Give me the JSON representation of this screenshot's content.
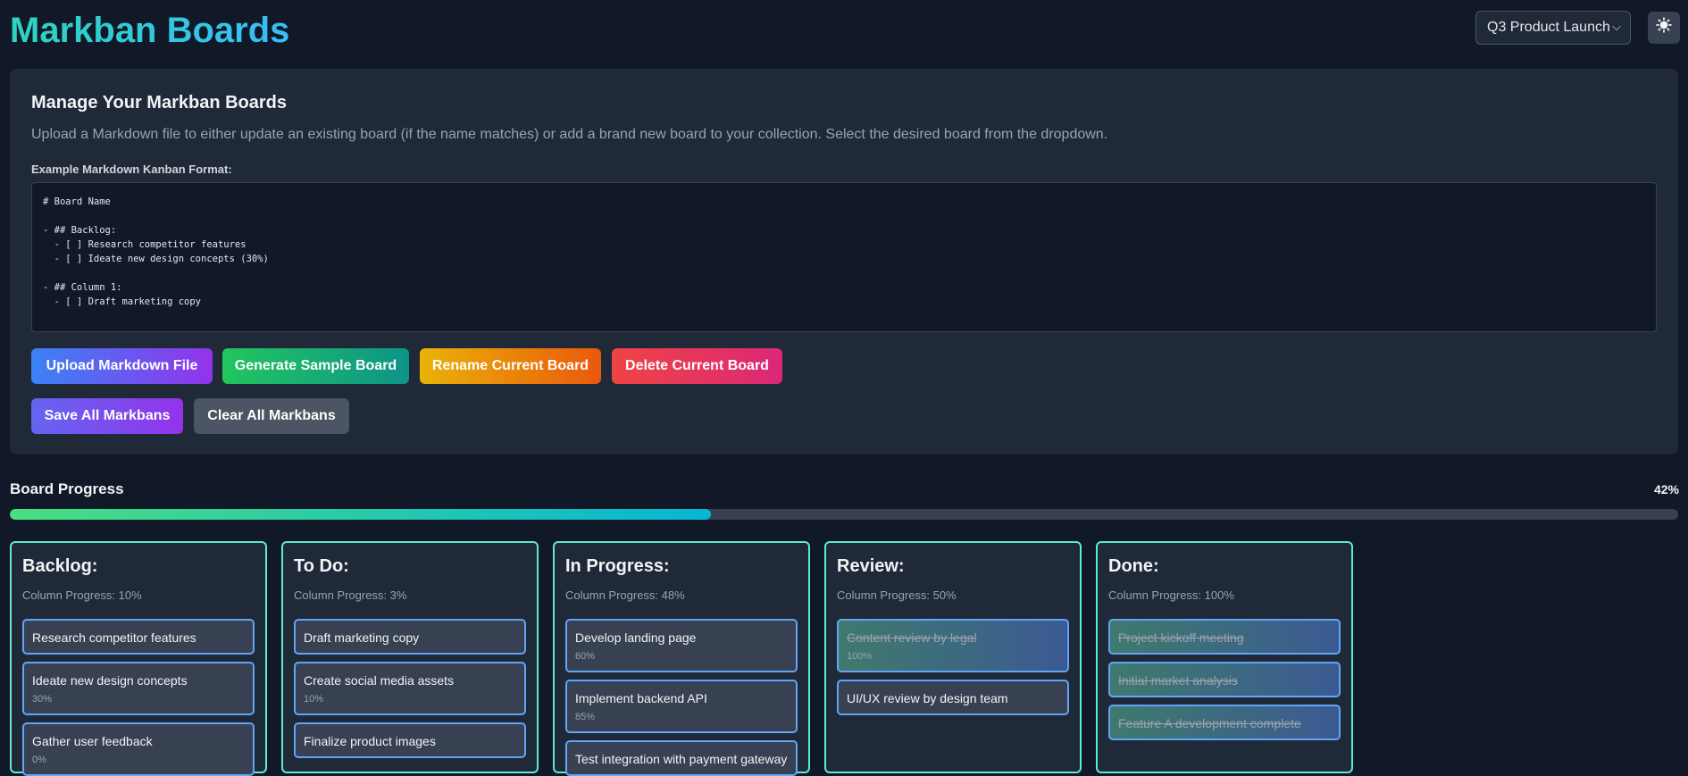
{
  "app": {
    "title": "Markban Boards"
  },
  "header": {
    "board_select_value": "Q3 Product Launch",
    "theme_icon": "sun-icon"
  },
  "manage": {
    "title": "Manage Your Markban Boards",
    "description": "Upload a Markdown file to either update an existing board (if the name matches) or add a brand new board to your collection. Select the desired board from the dropdown.",
    "example_label": "Example Markdown Kanban Format:",
    "example_code": "# Board Name\n\n- ## Backlog:\n  - [ ] Research competitor features\n  - [ ] Ideate new design concepts (30%)\n\n- ## Column 1:\n  - [ ] Draft marketing copy",
    "buttons": {
      "upload": "Upload Markdown File",
      "generate": "Generate Sample Board",
      "rename": "Rename Current Board",
      "delete": "Delete Current Board",
      "save_all": "Save All Markbans",
      "clear_all": "Clear All Markbans"
    }
  },
  "progress": {
    "label": "Board Progress",
    "percent_text": "42%",
    "value": 0.42
  },
  "columns": [
    {
      "title": "Backlog:",
      "progress": "Column Progress: 10%",
      "cards": [
        {
          "title": "Research competitor features",
          "pct": ""
        },
        {
          "title": "Ideate new design concepts",
          "pct": "30%"
        },
        {
          "title": "Gather user feedback",
          "pct": "0%"
        }
      ]
    },
    {
      "title": "To Do:",
      "progress": "Column Progress: 3%",
      "cards": [
        {
          "title": "Draft marketing copy",
          "pct": ""
        },
        {
          "title": "Create social media assets",
          "pct": "10%"
        },
        {
          "title": "Finalize product images",
          "pct": ""
        }
      ]
    },
    {
      "title": "In Progress:",
      "progress": "Column Progress: 48%",
      "cards": [
        {
          "title": "Develop landing page",
          "pct": "60%"
        },
        {
          "title": "Implement backend API",
          "pct": "85%"
        },
        {
          "title": "Test integration with payment gateway",
          "pct": ""
        }
      ]
    },
    {
      "title": "Review:",
      "progress": "Column Progress: 50%",
      "cards": [
        {
          "title": "Content review by legal",
          "pct": "100%",
          "done": true
        },
        {
          "title": "UI/UX review by design team",
          "pct": ""
        }
      ]
    },
    {
      "title": "Done:",
      "progress": "Column Progress: 100%",
      "cards": [
        {
          "title": "Project kickoff meeting",
          "pct": "",
          "done": true
        },
        {
          "title": "Initial market analysis",
          "pct": "",
          "done": true
        },
        {
          "title": "Feature A development complete",
          "pct": "",
          "done": true
        }
      ]
    }
  ]
}
